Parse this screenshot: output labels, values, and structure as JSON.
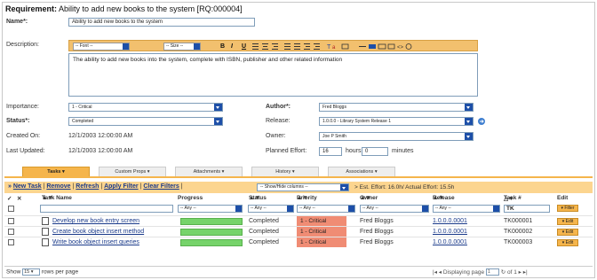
{
  "requirement": {
    "label": "Requirement:",
    "title": "Ability to add new books to the system [RQ:000004]"
  },
  "form": {
    "name_label": "Name*:",
    "name_value": "Ability to add new books to the system",
    "description_label": "Description:",
    "description_text": "The ability to add new books into the system, complete with ISBN, publisher and other related information",
    "toolbar": {
      "font_select": "-- Font --",
      "size_select": "-- Size --",
      "bold": "B",
      "italic": "I",
      "underline": "U"
    },
    "importance_label": "Importance:",
    "importance_value": "1 - Critical",
    "status_label": "Status*:",
    "status_value": "Completed",
    "created_label": "Created On:",
    "created_value": "12/1/2003 12:00:00 AM",
    "updated_label": "Last Updated:",
    "updated_value": "12/1/2003 12:00:00 AM",
    "author_label": "Author*:",
    "author_value": "Fred Bloggs",
    "release_label": "Release:",
    "release_value": "1.0.0.0 - Library System Release 1",
    "owner_label": "Owner:",
    "owner_value": "Joe P Smith",
    "effort_label": "Planned Effort:",
    "effort_hours": "16",
    "hours_label": "hours",
    "effort_minutes": "0",
    "minutes_label": "minutes"
  },
  "tabs": [
    {
      "label": "Tasks",
      "active": true
    },
    {
      "label": "Custom Props",
      "active": false
    },
    {
      "label": "Attachments",
      "active": false
    },
    {
      "label": "History",
      "active": false
    },
    {
      "label": "Associations",
      "active": false
    }
  ],
  "actions": {
    "new_task": "New Task",
    "remove": "Remove",
    "refresh": "Refresh",
    "apply_filter": "Apply Filter",
    "clear_filters": "Clear Filters",
    "columns_select": "-- Show/Hide columns --",
    "effort_summary": "Est. Effort: 16.0h/ Actual Effort: 15.5h"
  },
  "table": {
    "headers": {
      "task_name": "Task Name",
      "progress": "Progress",
      "status": "Status",
      "priority": "Priority",
      "owner": "Owner",
      "release": "Release",
      "task_num": "Task #",
      "edit": "Edit"
    },
    "filter_any": "-- Any --",
    "filter_tk": "TK",
    "filter_button": "Filter",
    "rows": [
      {
        "name": "Develop new book entry screen",
        "progress": 1.0,
        "status": "Completed",
        "priority": "1 - Critical",
        "owner": "Fred Bloggs",
        "release": "1.0.0.0.0001",
        "task": "TK000001",
        "edit": "Edit"
      },
      {
        "name": "Create book object insert method",
        "progress": 1.0,
        "status": "Completed",
        "priority": "1 - Critical",
        "owner": "Fred Bloggs",
        "release": "1.0.0.0.0001",
        "task": "TK000002",
        "edit": "Edit"
      },
      {
        "name": "Write book object insert queries",
        "progress": 1.0,
        "status": "Completed",
        "priority": "1 - Critical",
        "owner": "Fred Bloggs",
        "release": "1.0.0.0.0001",
        "task": "TK000003",
        "edit": "Edit"
      }
    ]
  },
  "footer": {
    "show_label": "Show",
    "page_size": "15",
    "rows_label": "rows per page",
    "displaying_label": "Displaying page",
    "page_value": "1",
    "of_label": "of 1"
  },
  "colors": {
    "accent": "#f5b54c",
    "progress": "#76d36a",
    "critical": "#f08c74",
    "link": "#1a3a8a"
  }
}
